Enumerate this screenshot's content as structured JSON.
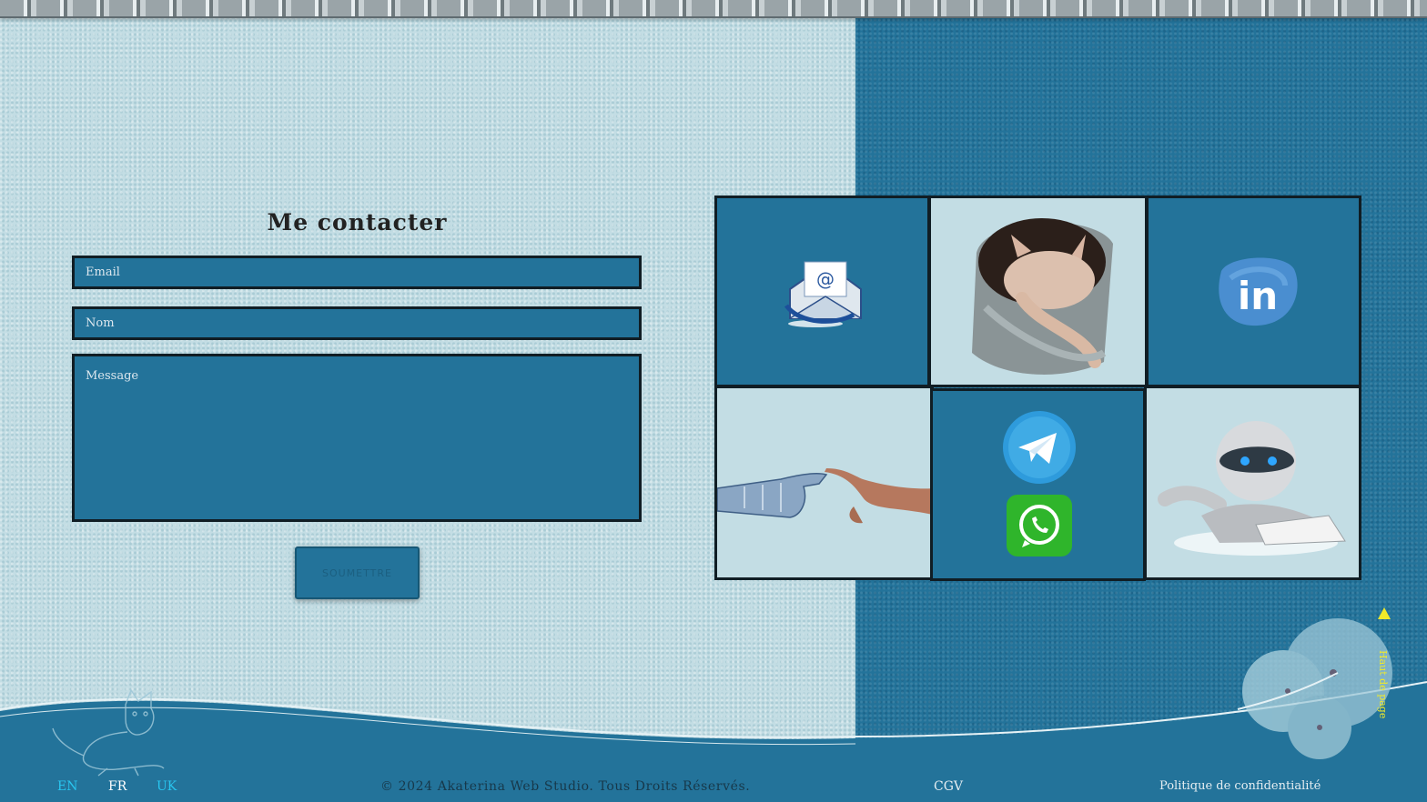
{
  "contact": {
    "title": "Me contacter",
    "email_placeholder": "Email",
    "name_placeholder": "Nom",
    "message_placeholder": "Message",
    "submit_label": "SOUMETTRE"
  },
  "footer": {
    "languages": [
      "EN",
      "FR",
      "UK"
    ],
    "copyright": "© 2024 Akaterina Web Studio. Tous Droits Réservés.",
    "cgv": "CGV",
    "privacy": "Politique de confidentialité",
    "back_to_top": "Haut de page"
  },
  "colors": {
    "dark_blue": "#23739a",
    "light_blue": "#c3dde4",
    "accent_yellow": "#f0ea2a",
    "lang_active": "#28c6f0"
  },
  "tiles": [
    {
      "icon": "email-envelope-icon"
    },
    {
      "icon": "sphynx-cat-image"
    },
    {
      "icon": "linkedin-icon"
    },
    {
      "icon": "robot-human-hands-image"
    },
    {
      "icon": "telegram-icon"
    },
    {
      "icon": "whatsapp-icon"
    },
    {
      "icon": "reading-robot-image"
    }
  ]
}
